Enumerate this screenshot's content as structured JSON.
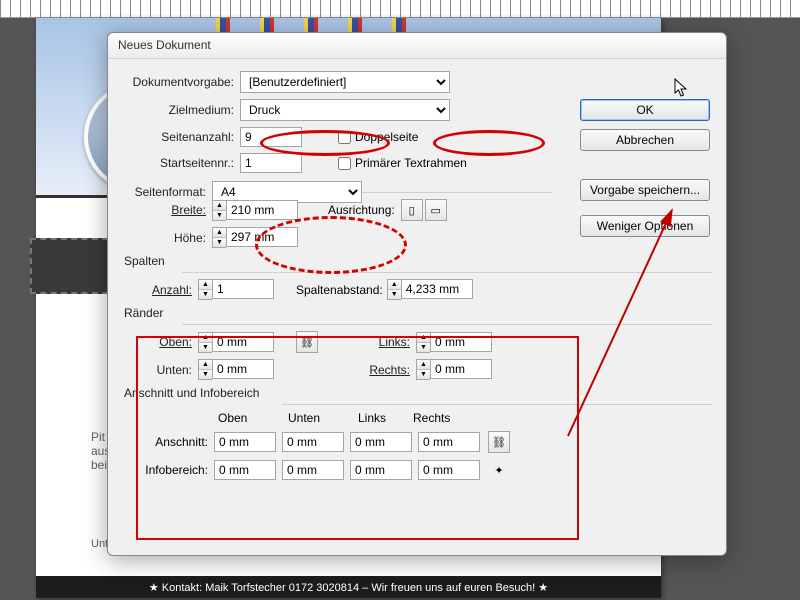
{
  "bg": {
    "text1": "Pit Pat -",
    "text2": "aus zwei F",
    "text3": "beim Billar",
    "text4": "Untersch",
    "footer": "★ Kontakt: Maik Torfstecher 0172 3020814 – Wir freuen uns auf euren Besuch! ★"
  },
  "dialog": {
    "title": "Neues Dokument",
    "fields": {
      "preset_label": "Dokumentvorgabe:",
      "preset_value": "[Benutzerdefiniert]",
      "intent_label": "Zielmedium:",
      "intent_value": "Druck",
      "pages_label": "Seitenanzahl:",
      "pages_value": "9",
      "facing_label": "Doppelseite",
      "startpage_label": "Startseitennr.:",
      "startpage_value": "1",
      "primary_tf_label": "Primärer Textrahmen",
      "pagesize_label": "Seitenformat:",
      "pagesize_value": "A4",
      "width_label": "Breite:",
      "width_value": "210 mm",
      "height_label": "Höhe:",
      "height_value": "297 mm",
      "orient_label": "Ausrichtung:"
    },
    "columns": {
      "group": "Spalten",
      "count_label": "Anzahl:",
      "count_value": "1",
      "gutter_label": "Spaltenabstand:",
      "gutter_value": "4,233 mm"
    },
    "margins": {
      "group": "Ränder",
      "top_label": "Oben:",
      "top_value": "0 mm",
      "bottom_label": "Unten:",
      "bottom_value": "0 mm",
      "left_label": "Links:",
      "left_value": "0 mm",
      "right_label": "Rechts:",
      "right_value": "0 mm"
    },
    "bleed": {
      "group": "Anschnitt und Infobereich",
      "col_top": "Oben",
      "col_bottom": "Unten",
      "col_left": "Links",
      "col_right": "Rechts",
      "bleed_label": "Anschnitt:",
      "slug_label": "Infobereich:",
      "zero": "0 mm"
    },
    "buttons": {
      "ok": "OK",
      "cancel": "Abbrechen",
      "save_preset": "Vorgabe speichern...",
      "fewer_opts": "Weniger Optionen"
    }
  }
}
